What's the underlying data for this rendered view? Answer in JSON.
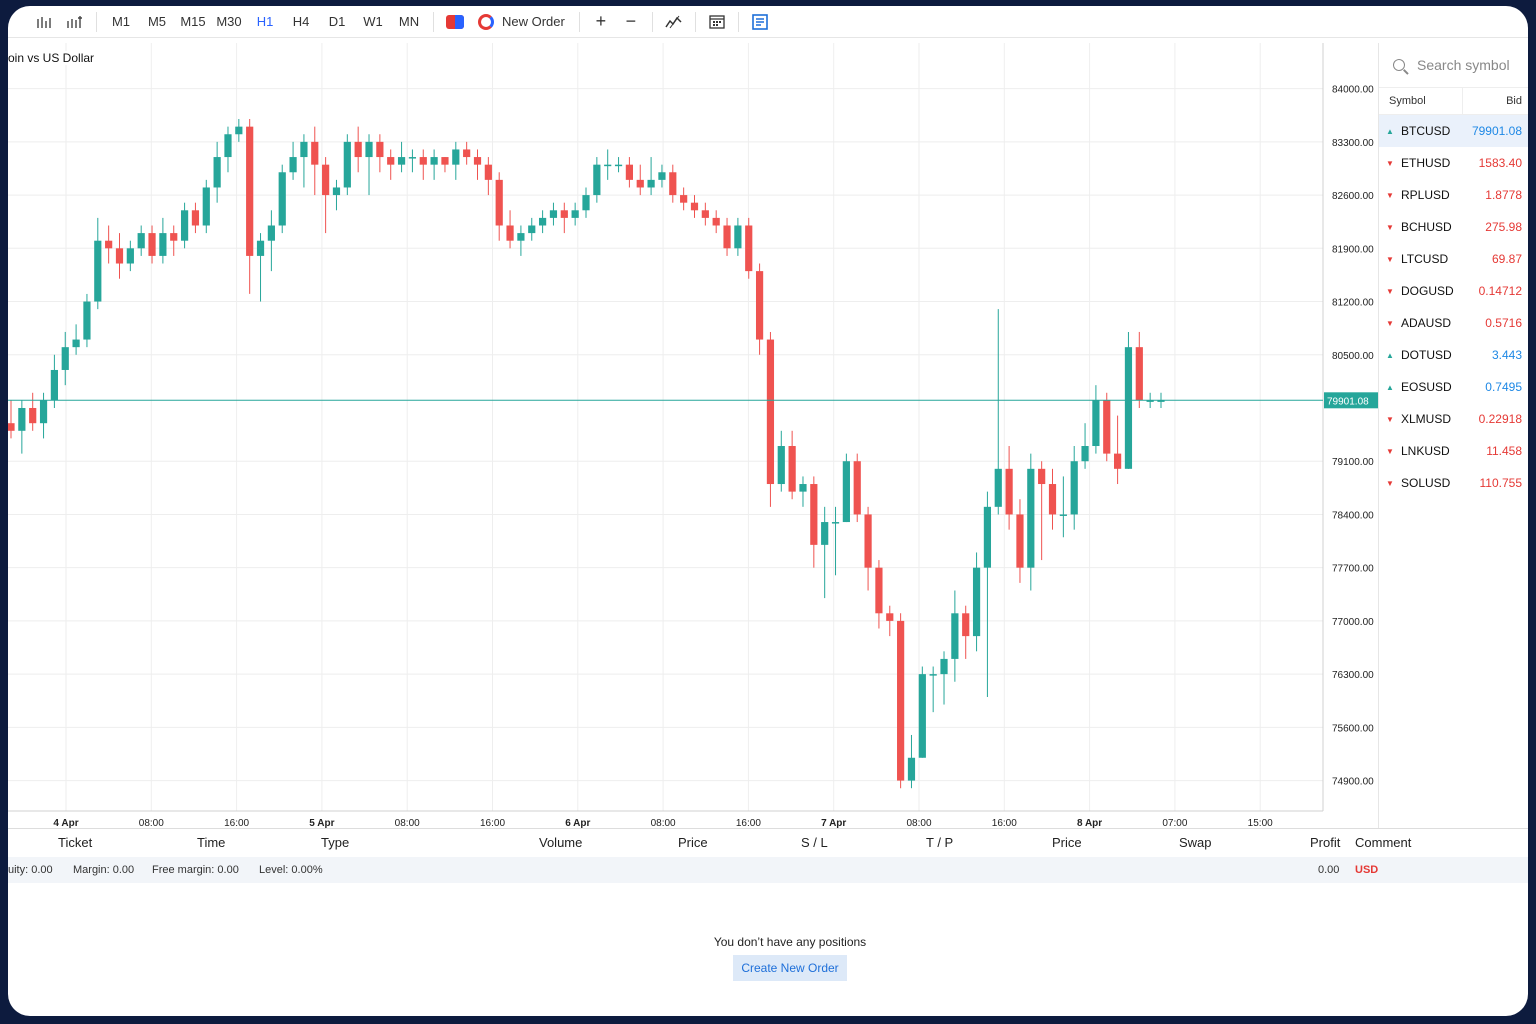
{
  "toolbar": {
    "chart_type_icons": [
      "bar-chart-icon",
      "candles-icon"
    ],
    "timeframes": [
      "M1",
      "M5",
      "M15",
      "M30",
      "H1",
      "H4",
      "D1",
      "W1",
      "MN"
    ],
    "active_timeframe": "H1",
    "new_order_label": "New Order",
    "zoom_in_label": "+",
    "zoom_out_label": "−"
  },
  "chart": {
    "title": "oin vs US Dollar",
    "current_price_label": "79901.08",
    "price_ticks": [
      "84000.00",
      "83300.00",
      "82600.00",
      "81900.00",
      "81200.00",
      "80500.00",
      "79100.00",
      "78400.00",
      "77700.00",
      "77000.00",
      "76300.00",
      "75600.00",
      "74900.00"
    ],
    "time_ticks": [
      "4 Apr",
      "08:00",
      "16:00",
      "5 Apr",
      "08:00",
      "16:00",
      "6 Apr",
      "08:00",
      "16:00",
      "7 Apr",
      "08:00",
      "16:00",
      "8 Apr",
      "07:00",
      "15:00"
    ],
    "colors": {
      "up": "#26a69a",
      "down": "#ef5350",
      "price_line": "#26a69a"
    }
  },
  "chart_data": {
    "type": "candlestick",
    "title": "oin vs US Dollar",
    "timeframe": "H1",
    "ylim": [
      74500,
      84600
    ],
    "last_price": 79901.08,
    "candles": [
      [
        79600,
        79500,
        79900,
        79400
      ],
      [
        79500,
        79800,
        79900,
        79200
      ],
      [
        79800,
        79600,
        80000,
        79500
      ],
      [
        79600,
        79900,
        80000,
        79400
      ],
      [
        79900,
        80300,
        80500,
        79800
      ],
      [
        80300,
        80600,
        80800,
        80100
      ],
      [
        80600,
        80700,
        80900,
        80500
      ],
      [
        80700,
        81200,
        81300,
        80600
      ],
      [
        81200,
        82000,
        82300,
        81100
      ],
      [
        82000,
        81900,
        82200,
        81700
      ],
      [
        81900,
        81700,
        82100,
        81500
      ],
      [
        81700,
        81900,
        82000,
        81600
      ],
      [
        81900,
        82100,
        82200,
        81800
      ],
      [
        82100,
        81800,
        82200,
        81700
      ],
      [
        81800,
        82100,
        82300,
        81700
      ],
      [
        82100,
        82000,
        82200,
        81800
      ],
      [
        82000,
        82400,
        82500,
        81900
      ],
      [
        82400,
        82200,
        82500,
        82100
      ],
      [
        82200,
        82700,
        82800,
        82100
      ],
      [
        82700,
        83100,
        83300,
        82500
      ],
      [
        83100,
        83400,
        83500,
        82900
      ],
      [
        83400,
        83500,
        83600,
        83300
      ],
      [
        83500,
        81800,
        83600,
        81300
      ],
      [
        81800,
        82000,
        82100,
        81200
      ],
      [
        82000,
        82200,
        82400,
        81600
      ],
      [
        82200,
        82900,
        83000,
        82100
      ],
      [
        82900,
        83100,
        83300,
        82800
      ],
      [
        83100,
        83300,
        83400,
        82700
      ],
      [
        83300,
        83000,
        83500,
        82600
      ],
      [
        83000,
        82600,
        83100,
        82100
      ],
      [
        82600,
        82700,
        82800,
        82400
      ],
      [
        82700,
        83300,
        83400,
        82600
      ],
      [
        83300,
        83100,
        83500,
        82900
      ],
      [
        83100,
        83300,
        83400,
        82600
      ],
      [
        83300,
        83100,
        83400,
        82900
      ],
      [
        83100,
        83000,
        83200,
        82800
      ],
      [
        83000,
        83100,
        83300,
        82900
      ],
      [
        83100,
        83100,
        83200,
        82900
      ],
      [
        83100,
        83000,
        83200,
        82800
      ],
      [
        83000,
        83100,
        83200,
        82800
      ],
      [
        83100,
        83000,
        83100,
        82900
      ],
      [
        83000,
        83200,
        83300,
        82800
      ],
      [
        83200,
        83100,
        83300,
        83000
      ],
      [
        83100,
        83000,
        83200,
        82800
      ],
      [
        83000,
        82800,
        83100,
        82600
      ],
      [
        82800,
        82200,
        82900,
        82000
      ],
      [
        82200,
        82000,
        82400,
        81900
      ],
      [
        82000,
        82100,
        82200,
        81800
      ],
      [
        82100,
        82200,
        82300,
        82000
      ],
      [
        82200,
        82300,
        82400,
        82100
      ],
      [
        82300,
        82400,
        82500,
        82200
      ],
      [
        82400,
        82300,
        82500,
        82100
      ],
      [
        82300,
        82400,
        82500,
        82200
      ],
      [
        82400,
        82600,
        82700,
        82300
      ],
      [
        82600,
        83000,
        83100,
        82500
      ],
      [
        83000,
        83000,
        83200,
        82800
      ],
      [
        83000,
        83000,
        83100,
        82900
      ],
      [
        83000,
        82800,
        83100,
        82700
      ],
      [
        82800,
        82700,
        83000,
        82600
      ],
      [
        82700,
        82800,
        83100,
        82600
      ],
      [
        82800,
        82900,
        83000,
        82700
      ],
      [
        82900,
        82600,
        83000,
        82500
      ],
      [
        82600,
        82500,
        82700,
        82400
      ],
      [
        82500,
        82400,
        82600,
        82300
      ],
      [
        82400,
        82300,
        82500,
        82200
      ],
      [
        82300,
        82200,
        82400,
        82100
      ],
      [
        82200,
        81900,
        82300,
        81800
      ],
      [
        81900,
        82200,
        82300,
        81800
      ],
      [
        82200,
        81600,
        82300,
        81500
      ],
      [
        81600,
        80700,
        81700,
        80500
      ],
      [
        80700,
        78800,
        80800,
        78500
      ],
      [
        78800,
        79300,
        79500,
        78700
      ],
      [
        79300,
        78700,
        79500,
        78600
      ],
      [
        78700,
        78800,
        78900,
        78500
      ],
      [
        78800,
        78000,
        78900,
        77700
      ],
      [
        78000,
        78300,
        78500,
        77300
      ],
      [
        78300,
        78300,
        78500,
        77600
      ],
      [
        78300,
        79100,
        79200,
        78300
      ],
      [
        79100,
        78400,
        79200,
        78300
      ],
      [
        78400,
        77700,
        78500,
        77400
      ],
      [
        77700,
        77100,
        77800,
        76900
      ],
      [
        77100,
        77000,
        77200,
        76800
      ],
      [
        77000,
        74900,
        77100,
        74800
      ],
      [
        74900,
        75200,
        75500,
        74800
      ],
      [
        75200,
        76300,
        76400,
        75200
      ],
      [
        76300,
        76300,
        76400,
        75800
      ],
      [
        76300,
        76500,
        76600,
        75900
      ],
      [
        76500,
        77100,
        77400,
        76200
      ],
      [
        77100,
        76800,
        77200,
        76500
      ],
      [
        76800,
        77700,
        77900,
        76600
      ],
      [
        77700,
        78500,
        78700,
        76000
      ],
      [
        78500,
        79000,
        81100,
        78400
      ],
      [
        79000,
        78400,
        79300,
        78200
      ],
      [
        78400,
        77700,
        78600,
        77500
      ],
      [
        77700,
        79000,
        79200,
        77400
      ],
      [
        79000,
        78800,
        79100,
        77800
      ],
      [
        78800,
        78400,
        79000,
        78200
      ],
      [
        78400,
        78400,
        78900,
        78100
      ],
      [
        78400,
        79100,
        79300,
        78200
      ],
      [
        79100,
        79300,
        79600,
        79000
      ],
      [
        79300,
        79900,
        80100,
        79200
      ],
      [
        79900,
        79200,
        80000,
        79100
      ],
      [
        79200,
        79000,
        79700,
        78800
      ],
      [
        79000,
        80600,
        80800,
        79000
      ],
      [
        80600,
        79900,
        80800,
        79800
      ],
      [
        79900,
        79900,
        80000,
        79800
      ],
      [
        79900,
        79900,
        80000,
        79800
      ]
    ]
  },
  "watchlist": {
    "search_placeholder": "Search symbol",
    "col_symbol": "Symbol",
    "col_bid": "Bid",
    "rows": [
      {
        "symbol": "BTCUSD",
        "bid": "79901.08",
        "dir": "up",
        "selected": true
      },
      {
        "symbol": "ETHUSD",
        "bid": "1583.40",
        "dir": "down"
      },
      {
        "symbol": "RPLUSD",
        "bid": "1.8778",
        "dir": "down"
      },
      {
        "symbol": "BCHUSD",
        "bid": "275.98",
        "dir": "down"
      },
      {
        "symbol": "LTCUSD",
        "bid": "69.87",
        "dir": "down"
      },
      {
        "symbol": "DOGUSD",
        "bid": "0.14712",
        "dir": "down"
      },
      {
        "symbol": "ADAUSD",
        "bid": "0.5716",
        "dir": "down"
      },
      {
        "symbol": "DOTUSD",
        "bid": "3.443",
        "dir": "up"
      },
      {
        "symbol": "EOSUSD",
        "bid": "0.7495",
        "dir": "up"
      },
      {
        "symbol": "XLMUSD",
        "bid": "0.22918",
        "dir": "down"
      },
      {
        "symbol": "LNKUSD",
        "bid": "11.458",
        "dir": "down"
      },
      {
        "symbol": "SOLUSD",
        "bid": "110.755",
        "dir": "down"
      }
    ]
  },
  "positions": {
    "headers": {
      "ticket": "Ticket",
      "time": "Time",
      "type": "Type",
      "volume": "Volume",
      "price": "Price",
      "sl": "S / L",
      "tp": "T / P",
      "price2": "Price",
      "swap": "Swap",
      "profit": "Profit",
      "comment": "Comment"
    },
    "account": {
      "equity": "uity: 0.00",
      "margin": "Margin: 0.00",
      "free_margin": "Free margin: 0.00",
      "level": "Level: 0.00%",
      "profit": "0.00",
      "currency": "USD"
    },
    "empty_message": "You don’t have any positions",
    "create_button": "Create New Order"
  }
}
